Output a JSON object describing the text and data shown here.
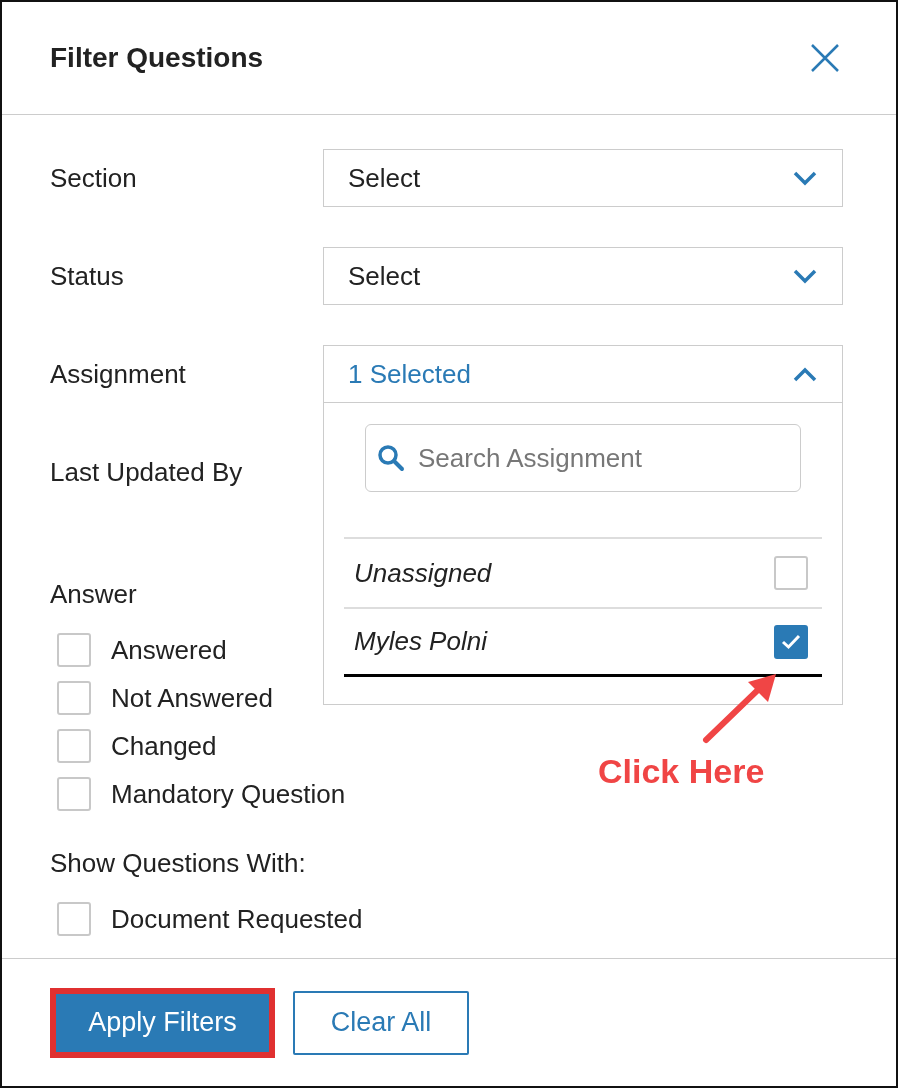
{
  "dialog": {
    "title": "Filter Questions"
  },
  "filters": [
    {
      "label": "Section",
      "value": "Select",
      "expanded": false
    },
    {
      "label": "Status",
      "value": "Select",
      "expanded": false
    },
    {
      "label": "Assignment",
      "value": "1 Selected",
      "expanded": true,
      "search_placeholder": "Search Assignment",
      "options": [
        {
          "label": "Unassigned",
          "checked": false,
          "focused": false
        },
        {
          "label": "Myles Polni",
          "checked": true,
          "focused": true
        }
      ]
    },
    {
      "label": "Last Updated By"
    }
  ],
  "answer": {
    "heading": "Answer",
    "options": [
      {
        "label": "Answered",
        "checked": false
      },
      {
        "label": "Not Answered",
        "checked": false
      },
      {
        "label": "Changed",
        "checked": false
      },
      {
        "label": "Mandatory Question",
        "checked": false
      }
    ]
  },
  "show_with": {
    "heading": "Show Questions With:",
    "options": [
      {
        "label": "Document Requested",
        "checked": false
      }
    ]
  },
  "buttons": [
    {
      "label": "Apply Filters",
      "kind": "primary",
      "highlighted": true
    },
    {
      "label": "Clear All",
      "kind": "secondary",
      "highlighted": false
    }
  ],
  "annotation": {
    "text": "Click Here"
  }
}
